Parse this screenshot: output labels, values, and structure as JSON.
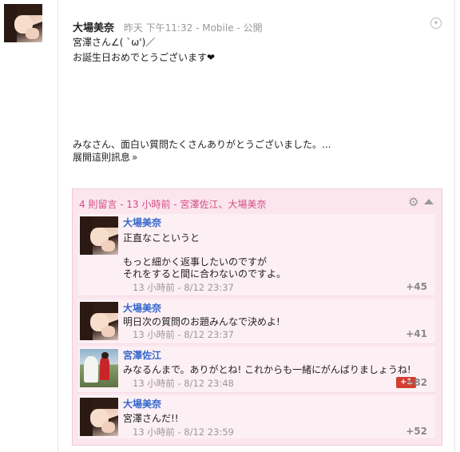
{
  "post": {
    "author": "大場美奈",
    "time": "昨天 下午11:32",
    "source": "Mobile",
    "visibility": "公開",
    "lines": [
      "宮澤さん∠( ˋω')／",
      "お誕生日おめでとうございます",
      "みなさん、面白い質問たくさんありがとうございました。..."
    ],
    "heart": "❤",
    "expand_label": "展開這則訊息",
    "expand_icon": "»"
  },
  "comments": {
    "summary": "4 則留言 - 13 小時前 - 宮澤佐江、大場美奈",
    "items": [
      {
        "author": "大場美奈",
        "lines": [
          "正直なこというと",
          "",
          "もっと細かく返事したいのですが",
          "それをすると間に合わないのですよ。"
        ],
        "time": "13 小時前 - 8/12 23:37",
        "plus": "+45"
      },
      {
        "author": "大場美奈",
        "lines": [
          "明日次の質問のお題みんなで決めよ!"
        ],
        "time": "13 小時前 - 8/12 23:37",
        "plus": "+41"
      },
      {
        "author": "宮澤佐江",
        "lines": [
          "みなるんまで。ありがとね! これからも一緒にがんばりましょうね!"
        ],
        "time": "13 小時前 - 8/12 23:48",
        "plus1": "+1",
        "plus": "+82"
      },
      {
        "author": "大場美奈",
        "lines": [
          "宮澤さんだ!!"
        ],
        "time": "13 小時前 - 8/12 23:59",
        "plus": "+52"
      }
    ]
  }
}
